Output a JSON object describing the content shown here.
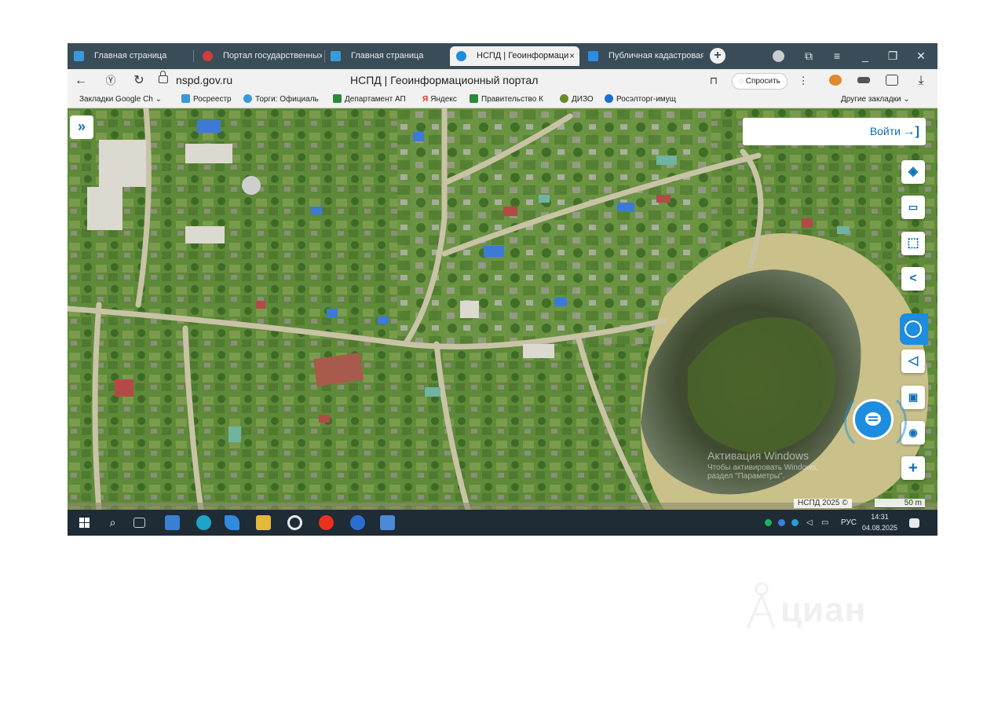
{
  "browser": {
    "tabs": [
      {
        "label": "Главная страница",
        "favicon_color": "#3a9ad9"
      },
      {
        "label": "Портал государственных",
        "favicon_color": "#d23c3c"
      },
      {
        "label": "Главная страница",
        "favicon_color": "#3a9ad9"
      },
      {
        "label": "НСПД | Геоинформаци",
        "favicon_color": "#1e8de0",
        "active": true,
        "close": "×"
      },
      {
        "label": "Публичная кадастровая",
        "favicon_color": "#2b8de0"
      }
    ],
    "new_tab": "+",
    "window_controls": {
      "profile": "",
      "collections": "⧉",
      "menu": "≡",
      "minimize": "_",
      "restore": "❐",
      "close": "✕"
    },
    "nav": {
      "back": "←",
      "yandex": "Ⓨ",
      "reload": "↻"
    },
    "url": "nspd.gov.ru",
    "page_title": "НСПД | Геоинформационный портал",
    "bookmark_icon": "⊓",
    "ask_button": "Спросить",
    "more": "⋮",
    "download": "⤓",
    "bookmarks": [
      {
        "label": "Закладки Google Ch",
        "has_arrow": true
      },
      {
        "label": "Росреестр",
        "color": "#3a9ad9"
      },
      {
        "label": "Торги: Официаль",
        "color": "#3a9ad9"
      },
      {
        "label": "Департамент АП",
        "color": "#2a8a3a"
      },
      {
        "label": "Яндекс",
        "color": "#e8321e"
      },
      {
        "label": "Правительство К",
        "color": "#2a8a3a"
      },
      {
        "label": "ДИЗО",
        "color": "#6a8a2a"
      },
      {
        "label": "Росэлторг-имущ",
        "color": "#1f6fd0"
      }
    ],
    "other_bookmarks": "Другие закладки ⌄"
  },
  "map": {
    "expand_button": "»",
    "login": {
      "label": "Войти",
      "icon": "→]"
    },
    "toolbar": [
      {
        "name": "layers-icon",
        "glyph": "◈"
      },
      {
        "name": "ruler-icon",
        "glyph": "▭"
      },
      {
        "name": "select-area-icon",
        "glyph": "⬚"
      },
      {
        "name": "share-icon",
        "glyph": "<"
      },
      {
        "name": "navigate-icon",
        "glyph": "◁"
      },
      {
        "name": "minimap-icon",
        "glyph": "▣"
      },
      {
        "name": "locate-icon",
        "glyph": "◉"
      },
      {
        "name": "zoom-in-icon",
        "glyph": "+"
      }
    ],
    "activation": {
      "line1": "Активация Windows",
      "line2": "Чтобы активировать Windows,",
      "line3": "раздел \"Параметры\"."
    },
    "copyright": "НСПД 2025 ©",
    "scale": "50 m"
  },
  "taskbar": {
    "language": "РУС",
    "time": "14:31",
    "date": "04.08.2025"
  },
  "watermark": "циан"
}
